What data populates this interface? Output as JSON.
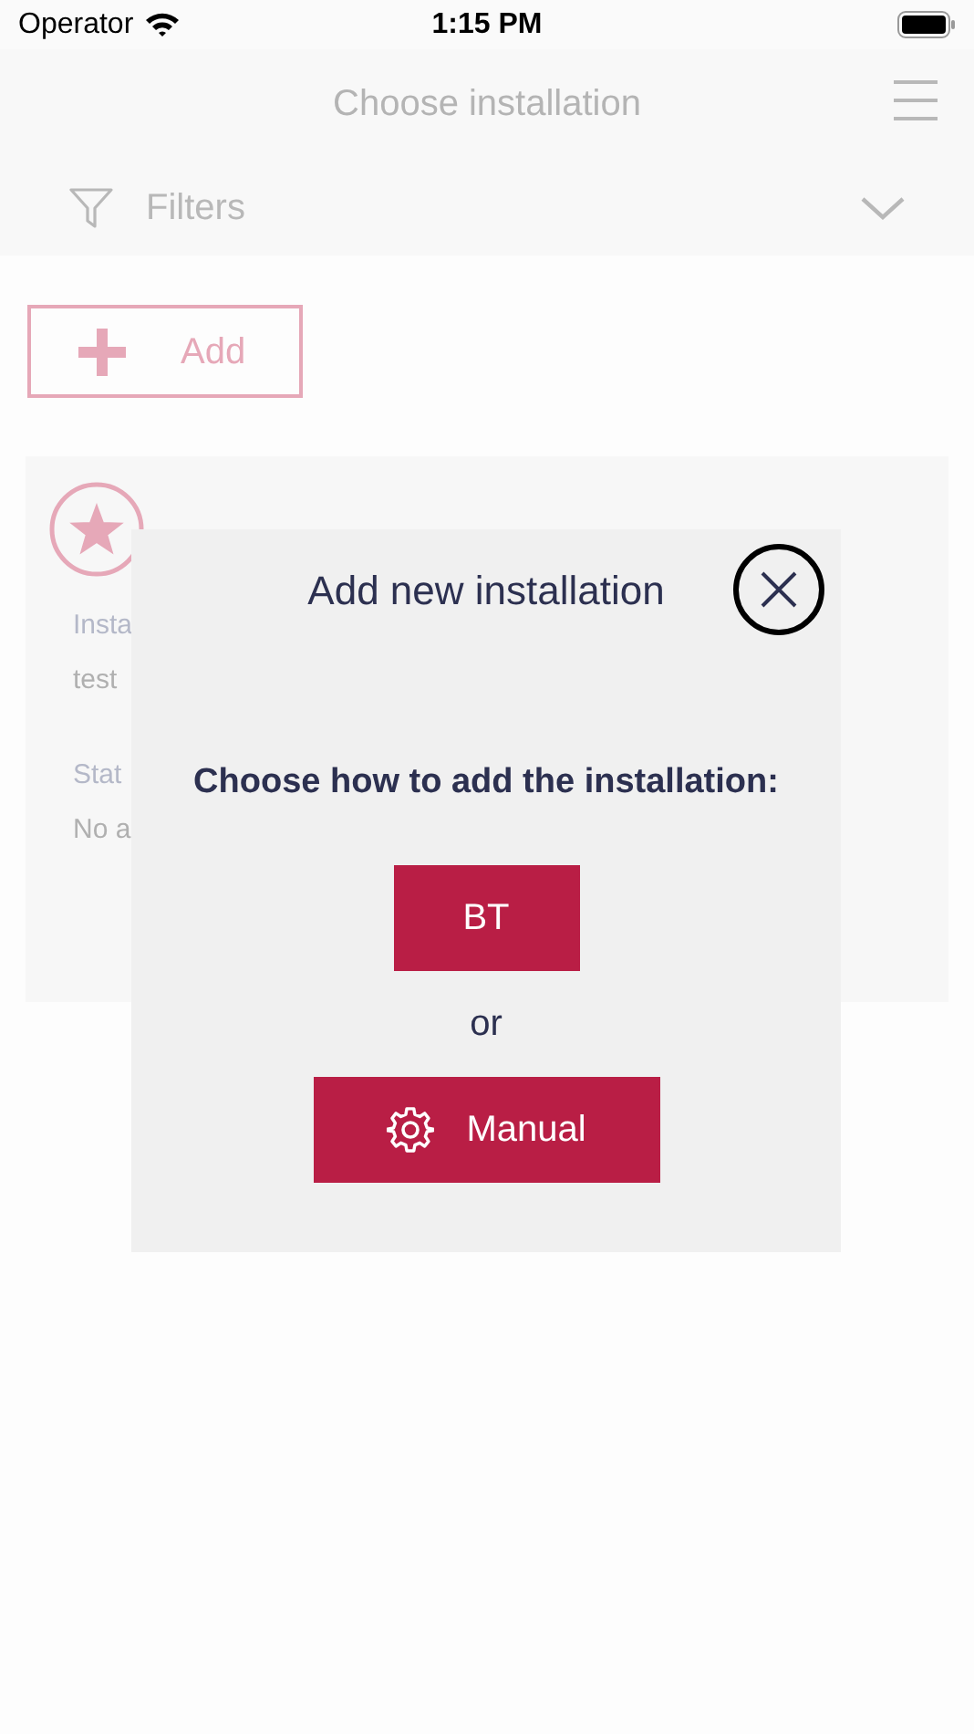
{
  "status_bar": {
    "carrier": "Operator",
    "time": "1:15 PM"
  },
  "header": {
    "title": "Choose installation"
  },
  "filters": {
    "label": "Filters",
    "expanded": false
  },
  "add_button": {
    "label": "Add"
  },
  "installation_card": {
    "favorite": true,
    "fields": [
      {
        "label": "Insta",
        "value": "test"
      },
      {
        "label": "Stat",
        "value": "No a"
      }
    ]
  },
  "dialog": {
    "title": "Add new installation",
    "prompt": "Choose how to add the installation:",
    "options": [
      {
        "kind": "plain",
        "label": "BT"
      },
      {
        "kind": "gear",
        "label": "Manual"
      }
    ],
    "separator": "or"
  }
}
